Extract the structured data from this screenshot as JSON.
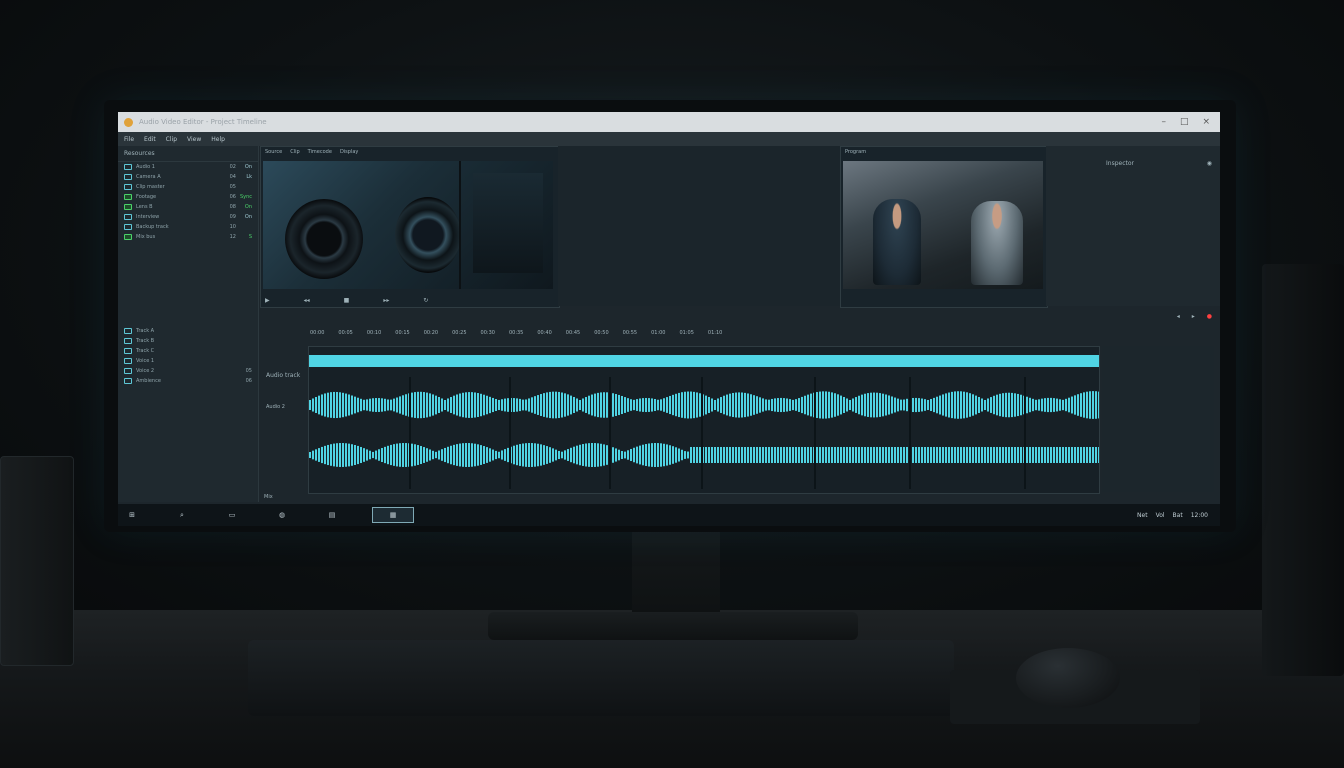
{
  "window": {
    "title": "Audio Video Editor - Project Timeline"
  },
  "menu": [
    "File",
    "Edit",
    "Clip",
    "View",
    "Help"
  ],
  "left_panel": {
    "header": "Resources",
    "rows": [
      {
        "name": "Audio 1",
        "value": "02",
        "flag": "On"
      },
      {
        "name": "Camera A",
        "value": "04",
        "flag": "Lk"
      },
      {
        "name": "Clip master",
        "value": "05",
        "flag": ""
      },
      {
        "name": "Footage",
        "value": "06",
        "flag": "Sync",
        "green": true
      },
      {
        "name": "Lens B",
        "value": "08",
        "flag": "On",
        "green": true
      },
      {
        "name": "Interview",
        "value": "09",
        "flag": "On"
      },
      {
        "name": "Backup track",
        "value": "10",
        "flag": ""
      },
      {
        "name": "Mix bus",
        "value": "12",
        "flag": "S",
        "green": true
      }
    ],
    "lower_rows": [
      {
        "name": "Track A",
        "value": ""
      },
      {
        "name": "Track B",
        "value": ""
      },
      {
        "name": "Track C",
        "value": ""
      },
      {
        "name": "Voice 1",
        "value": ""
      },
      {
        "name": "Voice 2",
        "value": "05"
      },
      {
        "name": "Ambience",
        "value": "06"
      }
    ]
  },
  "viewer_left": {
    "header": [
      "Source",
      "Clip",
      "Timecode",
      "Display"
    ]
  },
  "viewer_right": {
    "header": "Program"
  },
  "inspector": {
    "header": "Inspector"
  },
  "timeline": {
    "ruler": [
      "00:00",
      "00:05",
      "00:10",
      "00:15",
      "00:20",
      "00:25",
      "00:30",
      "00:35",
      "00:40",
      "00:45",
      "00:50",
      "00:55",
      "01:00",
      "01:05",
      "01:10"
    ],
    "track_labels": [
      "Audio track",
      "Audio 2",
      "Mix"
    ],
    "toolbar": [
      "◂",
      "▸",
      "●"
    ]
  },
  "taskbar": {
    "tray": [
      "Net",
      "Vol",
      "Bat",
      "12:00"
    ]
  },
  "colors": {
    "accent": "#50d4e4",
    "record": "#ff4040"
  }
}
